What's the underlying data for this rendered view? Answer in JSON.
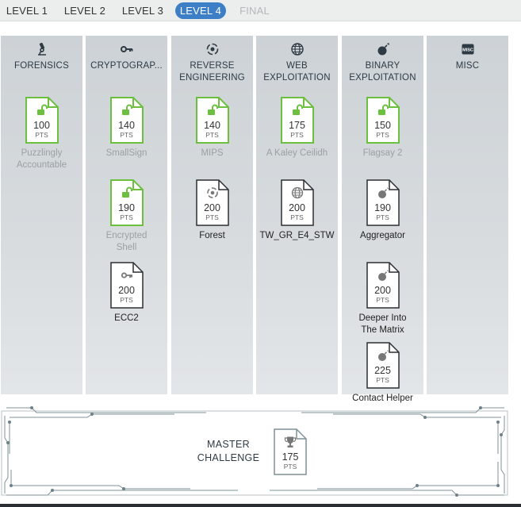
{
  "tabs": [
    {
      "label": "LEVEL 1",
      "state": "normal"
    },
    {
      "label": "LEVEL 2",
      "state": "normal"
    },
    {
      "label": "LEVEL 3",
      "state": "normal"
    },
    {
      "label": "LEVEL 4",
      "state": "active"
    },
    {
      "label": "FINAL",
      "state": "disabled"
    }
  ],
  "colors": {
    "accent": "#3d7fc6",
    "solved_green": "#6cbf3f",
    "column_bg": "#d3d8db",
    "text_dark": "#2e3a44"
  },
  "pts_label": "PTS",
  "categories": [
    {
      "title_lines": [
        "FORENSICS",
        ""
      ],
      "icon": "microscope-icon",
      "challenges": [
        {
          "points": "100",
          "name_lines": [
            "Puzzlingly",
            "Accountable"
          ],
          "solved": true,
          "icon": "padlock-open-icon"
        }
      ]
    },
    {
      "title_lines": [
        "CRYPTOGRAP...",
        ""
      ],
      "icon": "key-icon",
      "challenges": [
        {
          "points": "140",
          "name_lines": [
            "SmallSign",
            ""
          ],
          "solved": true,
          "icon": "padlock-open-icon"
        },
        {
          "points": "190",
          "name_lines": [
            "Encrypted",
            "Shell"
          ],
          "solved": true,
          "icon": "padlock-open-icon"
        },
        {
          "points": "200",
          "name_lines": [
            "ECC2",
            ""
          ],
          "solved": false,
          "icon": "key-icon"
        }
      ]
    },
    {
      "title_lines": [
        "REVERSE",
        "ENGINEERING"
      ],
      "icon": "reverse-icon",
      "challenges": [
        {
          "points": "140",
          "name_lines": [
            "MIPS",
            ""
          ],
          "solved": true,
          "icon": "padlock-open-icon"
        },
        {
          "points": "200",
          "name_lines": [
            "Forest",
            ""
          ],
          "solved": false,
          "icon": "reverse-icon"
        }
      ]
    },
    {
      "title_lines": [
        "WEB",
        "EXPLOITATION"
      ],
      "icon": "globe-icon",
      "challenges": [
        {
          "points": "175",
          "name_lines": [
            "A Kaley Ceilidh",
            ""
          ],
          "solved": true,
          "icon": "padlock-open-icon"
        },
        {
          "points": "200",
          "name_lines": [
            "TW_GR_E4_STW",
            ""
          ],
          "solved": false,
          "icon": "globe-icon"
        }
      ]
    },
    {
      "title_lines": [
        "BINARY",
        "EXPLOITATION"
      ],
      "icon": "bomb-icon",
      "challenges": [
        {
          "points": "150",
          "name_lines": [
            "Flagsay 2",
            ""
          ],
          "solved": true,
          "icon": "padlock-open-icon"
        },
        {
          "points": "190",
          "name_lines": [
            "Aggregator",
            ""
          ],
          "solved": false,
          "icon": "bomb-icon"
        },
        {
          "points": "200",
          "name_lines": [
            "Deeper Into",
            "The Matrix"
          ],
          "solved": false,
          "icon": "bomb-icon"
        },
        {
          "points": "225",
          "name_lines": [
            "Contact Helper",
            ""
          ],
          "solved": false,
          "icon": "bomb-icon"
        }
      ]
    },
    {
      "title_lines": [
        "MISC",
        ""
      ],
      "icon": "misc-icon",
      "challenges": []
    }
  ],
  "master": {
    "title_lines": [
      "MASTER",
      "CHALLENGE"
    ],
    "points": "175",
    "icon": "trophy-icon"
  }
}
